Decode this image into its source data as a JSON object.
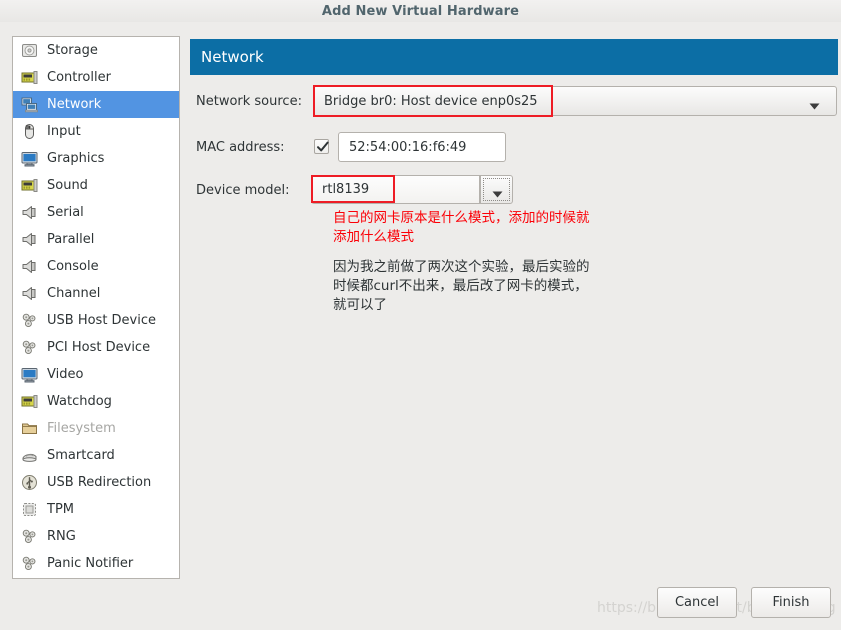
{
  "window": {
    "title": "Add New Virtual Hardware"
  },
  "sidebar": {
    "items": [
      {
        "label": "Storage",
        "icon": "storage-icon",
        "selected": false,
        "disabled": false
      },
      {
        "label": "Controller",
        "icon": "controller-icon",
        "selected": false,
        "disabled": false
      },
      {
        "label": "Network",
        "icon": "network-icon",
        "selected": true,
        "disabled": false
      },
      {
        "label": "Input",
        "icon": "input-mouse-icon",
        "selected": false,
        "disabled": false
      },
      {
        "label": "Graphics",
        "icon": "graphics-monitor-icon",
        "selected": false,
        "disabled": false
      },
      {
        "label": "Sound",
        "icon": "sound-card-icon",
        "selected": false,
        "disabled": false
      },
      {
        "label": "Serial",
        "icon": "serial-port-icon",
        "selected": false,
        "disabled": false
      },
      {
        "label": "Parallel",
        "icon": "parallel-port-icon",
        "selected": false,
        "disabled": false
      },
      {
        "label": "Console",
        "icon": "console-port-icon",
        "selected": false,
        "disabled": false
      },
      {
        "label": "Channel",
        "icon": "channel-port-icon",
        "selected": false,
        "disabled": false
      },
      {
        "label": "USB Host Device",
        "icon": "usb-host-device-icon",
        "selected": false,
        "disabled": false
      },
      {
        "label": "PCI Host Device",
        "icon": "pci-host-device-icon",
        "selected": false,
        "disabled": false
      },
      {
        "label": "Video",
        "icon": "video-monitor-icon",
        "selected": false,
        "disabled": false
      },
      {
        "label": "Watchdog",
        "icon": "watchdog-card-icon",
        "selected": false,
        "disabled": false
      },
      {
        "label": "Filesystem",
        "icon": "filesystem-folder-icon",
        "selected": false,
        "disabled": true
      },
      {
        "label": "Smartcard",
        "icon": "smartcard-icon",
        "selected": false,
        "disabled": false
      },
      {
        "label": "USB Redirection",
        "icon": "usb-redirection-icon",
        "selected": false,
        "disabled": false
      },
      {
        "label": "TPM",
        "icon": "tpm-chip-icon",
        "selected": false,
        "disabled": false
      },
      {
        "label": "RNG",
        "icon": "rng-icon",
        "selected": false,
        "disabled": false
      },
      {
        "label": "Panic Notifier",
        "icon": "panic-notifier-icon",
        "selected": false,
        "disabled": false
      }
    ]
  },
  "panel": {
    "banner_title": "Network",
    "fields": {
      "network_source": {
        "label": "Network source:",
        "value": "Bridge br0: Host device enp0s25"
      },
      "mac_address": {
        "label": "MAC address:",
        "value": "52:54:00:16:f6:49",
        "checked": true
      },
      "device_model": {
        "label": "Device model:",
        "value": "rtl8139"
      }
    },
    "annotations": {
      "red": "自己的网卡原本是什么模式，添加的时候就添加什么模式",
      "black": "因为我之前做了两次这个实验，最后实验的时候都curl不出来，最后改了网卡的模式，就可以了"
    }
  },
  "footer": {
    "cancel_label": "Cancel",
    "finish_label": "Finish",
    "watermark": "https://blog.csdn.net/bmengmeng"
  },
  "colors": {
    "banner_blue": "#0c6ea5",
    "selection_blue": "#5294e2",
    "highlight_red": "#ee1c25",
    "annotation_red": "#fb0007"
  }
}
